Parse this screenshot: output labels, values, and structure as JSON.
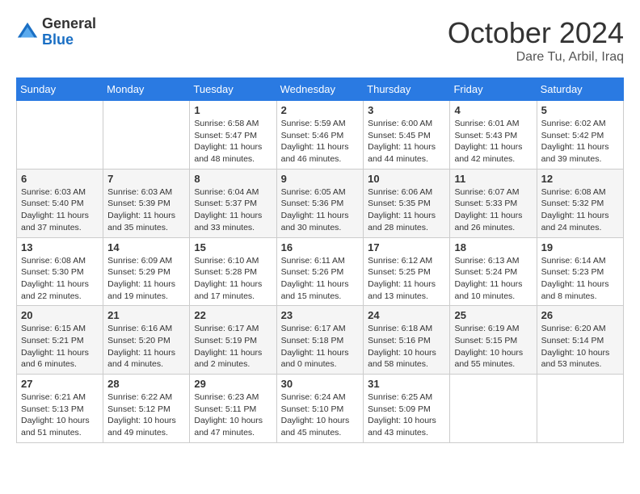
{
  "header": {
    "logo": {
      "line1": "General",
      "line2": "Blue"
    },
    "title": "October 2024",
    "location": "Dare Tu, Arbil, Iraq"
  },
  "weekdays": [
    "Sunday",
    "Monday",
    "Tuesday",
    "Wednesday",
    "Thursday",
    "Friday",
    "Saturday"
  ],
  "weeks": [
    [
      null,
      null,
      {
        "day": 1,
        "sunrise": "6:58 AM",
        "sunset": "5:47 PM",
        "daylight": "11 hours and 48 minutes."
      },
      {
        "day": 2,
        "sunrise": "5:59 AM",
        "sunset": "5:46 PM",
        "daylight": "11 hours and 46 minutes."
      },
      {
        "day": 3,
        "sunrise": "6:00 AM",
        "sunset": "5:45 PM",
        "daylight": "11 hours and 44 minutes."
      },
      {
        "day": 4,
        "sunrise": "6:01 AM",
        "sunset": "5:43 PM",
        "daylight": "11 hours and 42 minutes."
      },
      {
        "day": 5,
        "sunrise": "6:02 AM",
        "sunset": "5:42 PM",
        "daylight": "11 hours and 39 minutes."
      }
    ],
    [
      {
        "day": 6,
        "sunrise": "6:03 AM",
        "sunset": "5:40 PM",
        "daylight": "11 hours and 37 minutes."
      },
      {
        "day": 7,
        "sunrise": "6:03 AM",
        "sunset": "5:39 PM",
        "daylight": "11 hours and 35 minutes."
      },
      {
        "day": 8,
        "sunrise": "6:04 AM",
        "sunset": "5:37 PM",
        "daylight": "11 hours and 33 minutes."
      },
      {
        "day": 9,
        "sunrise": "6:05 AM",
        "sunset": "5:36 PM",
        "daylight": "11 hours and 30 minutes."
      },
      {
        "day": 10,
        "sunrise": "6:06 AM",
        "sunset": "5:35 PM",
        "daylight": "11 hours and 28 minutes."
      },
      {
        "day": 11,
        "sunrise": "6:07 AM",
        "sunset": "5:33 PM",
        "daylight": "11 hours and 26 minutes."
      },
      {
        "day": 12,
        "sunrise": "6:08 AM",
        "sunset": "5:32 PM",
        "daylight": "11 hours and 24 minutes."
      }
    ],
    [
      {
        "day": 13,
        "sunrise": "6:08 AM",
        "sunset": "5:30 PM",
        "daylight": "11 hours and 22 minutes."
      },
      {
        "day": 14,
        "sunrise": "6:09 AM",
        "sunset": "5:29 PM",
        "daylight": "11 hours and 19 minutes."
      },
      {
        "day": 15,
        "sunrise": "6:10 AM",
        "sunset": "5:28 PM",
        "daylight": "11 hours and 17 minutes."
      },
      {
        "day": 16,
        "sunrise": "6:11 AM",
        "sunset": "5:26 PM",
        "daylight": "11 hours and 15 minutes."
      },
      {
        "day": 17,
        "sunrise": "6:12 AM",
        "sunset": "5:25 PM",
        "daylight": "11 hours and 13 minutes."
      },
      {
        "day": 18,
        "sunrise": "6:13 AM",
        "sunset": "5:24 PM",
        "daylight": "11 hours and 10 minutes."
      },
      {
        "day": 19,
        "sunrise": "6:14 AM",
        "sunset": "5:23 PM",
        "daylight": "11 hours and 8 minutes."
      }
    ],
    [
      {
        "day": 20,
        "sunrise": "6:15 AM",
        "sunset": "5:21 PM",
        "daylight": "11 hours and 6 minutes."
      },
      {
        "day": 21,
        "sunrise": "6:16 AM",
        "sunset": "5:20 PM",
        "daylight": "11 hours and 4 minutes."
      },
      {
        "day": 22,
        "sunrise": "6:17 AM",
        "sunset": "5:19 PM",
        "daylight": "11 hours and 2 minutes."
      },
      {
        "day": 23,
        "sunrise": "6:17 AM",
        "sunset": "5:18 PM",
        "daylight": "11 hours and 0 minutes."
      },
      {
        "day": 24,
        "sunrise": "6:18 AM",
        "sunset": "5:16 PM",
        "daylight": "10 hours and 58 minutes."
      },
      {
        "day": 25,
        "sunrise": "6:19 AM",
        "sunset": "5:15 PM",
        "daylight": "10 hours and 55 minutes."
      },
      {
        "day": 26,
        "sunrise": "6:20 AM",
        "sunset": "5:14 PM",
        "daylight": "10 hours and 53 minutes."
      }
    ],
    [
      {
        "day": 27,
        "sunrise": "6:21 AM",
        "sunset": "5:13 PM",
        "daylight": "10 hours and 51 minutes."
      },
      {
        "day": 28,
        "sunrise": "6:22 AM",
        "sunset": "5:12 PM",
        "daylight": "10 hours and 49 minutes."
      },
      {
        "day": 29,
        "sunrise": "6:23 AM",
        "sunset": "5:11 PM",
        "daylight": "10 hours and 47 minutes."
      },
      {
        "day": 30,
        "sunrise": "6:24 AM",
        "sunset": "5:10 PM",
        "daylight": "10 hours and 45 minutes."
      },
      {
        "day": 31,
        "sunrise": "6:25 AM",
        "sunset": "5:09 PM",
        "daylight": "10 hours and 43 minutes."
      },
      null,
      null
    ]
  ]
}
